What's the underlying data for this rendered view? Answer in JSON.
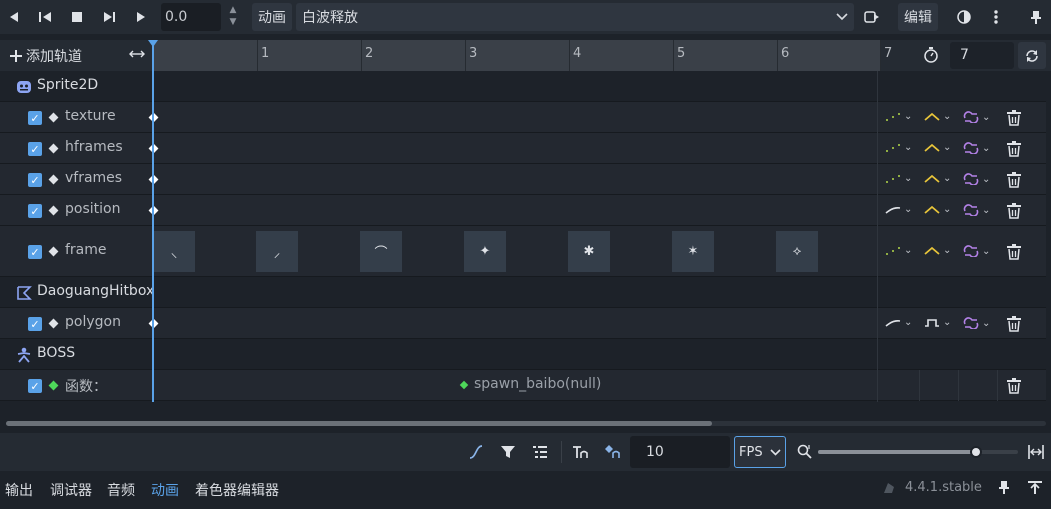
{
  "toolbar": {
    "time_value": "0.0",
    "anim_button": "动画",
    "animation_name": "白波释放",
    "edit_button": "编辑"
  },
  "timeline": {
    "add_track": "添加轨道",
    "ticks": [
      "1",
      "2",
      "3",
      "4",
      "5",
      "6",
      "7"
    ],
    "length_value": "7"
  },
  "tracks": {
    "node1": "Sprite2D",
    "texture": "texture",
    "hframes": "hframes",
    "vframes": "vframes",
    "position": "position",
    "frame": "frame",
    "node2": "DaoguangHitbox",
    "polygon": "polygon",
    "node3": "BOSS",
    "func": "函数：",
    "func_key": "spawn_baibo(null)"
  },
  "bottom": {
    "snap_value": "10",
    "fps_label": "FPS",
    "zoom_level": 0.79
  },
  "status": {
    "tabs": [
      "输出",
      "调试器",
      "音频",
      "动画",
      "着色器编辑器"
    ],
    "active_tab": "动画",
    "version": "4.4.1.stable"
  },
  "colors": {
    "accent": "#5aa2e8",
    "playhead": "#5aa2e8",
    "interp_yellow": "#e8c53a",
    "loop_purple": "#b482e8",
    "discrete_green": "#b4d84a"
  }
}
